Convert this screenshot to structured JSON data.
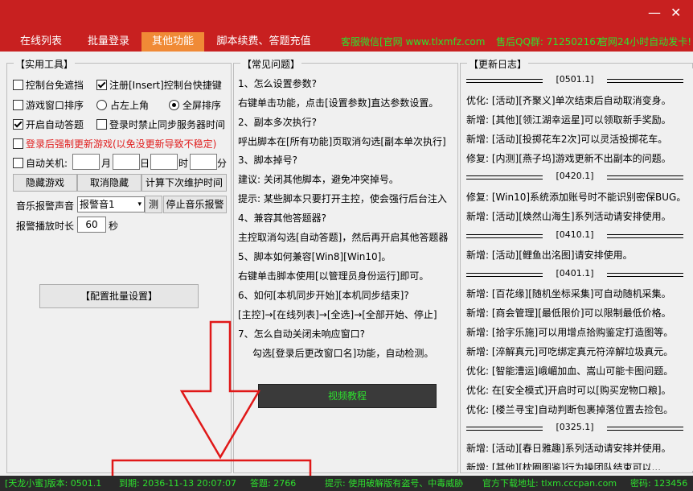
{
  "window": {
    "minimize_label": "—",
    "close_label": "✕"
  },
  "tabs": [
    {
      "label": "在线列表",
      "active": false
    },
    {
      "label": "批量登录",
      "active": false
    },
    {
      "label": "其他功能",
      "active": true
    },
    {
      "label": "脚本续费、答题充值",
      "active": false
    }
  ],
  "header_info": {
    "service": "客服微信[官网  www.tlxmfz.com",
    "qq": "售后QQ群: 712502167",
    "notice": "官网24小时自动发卡!"
  },
  "tools": {
    "title": "【实用工具】",
    "options": [
      {
        "label": "控制台免遮挡",
        "checked": false
      },
      {
        "label": "注册[Insert]控制台快捷键",
        "checked": true
      },
      {
        "label": "游戏窗口排序",
        "checked": false
      },
      {
        "label": "开启自动答题",
        "checked": true
      },
      {
        "label": "登录时禁止同步服务器时间",
        "checked": false
      },
      {
        "label": "登录后强制更新游戏(以免没更新导致不稳定)",
        "checked": false
      },
      {
        "label": "自动关机:",
        "checked": false
      }
    ],
    "radio": [
      {
        "label": "占左上角",
        "checked": false
      },
      {
        "label": "全屏排序",
        "checked": true
      }
    ],
    "shutdown_units": [
      "月",
      "日",
      "时",
      "分"
    ],
    "buttons": {
      "hide_game": "隐藏游戏",
      "cancel_hide": "取消隐藏",
      "calc_maint": "计算下次维护时间"
    },
    "music_label": "音乐报警声音",
    "music_select": "报警音1",
    "test_button": "测",
    "stop_music": "停止音乐报警",
    "duration_label": "报警播放时长",
    "duration_value": "60",
    "duration_unit": "秒",
    "batch_config": "【配置批量设置】"
  },
  "faq": {
    "title": "【常见问题】",
    "lines": [
      "1、怎么设置参数?",
      "右键单击功能，点击[设置参数]直达参数设置。",
      "2、副本多次执行?",
      "呼出脚本在[所有功能]页取消勾选[副本单次执行]",
      "3、脚本掉号?",
      "建议: 关闭其他脚本，避免冲突掉号。",
      "提示: 某些脚本只要打开主控，使会强行后台注入",
      "4、兼容其他答题器?",
      "主控取消勾选[自动答题]，然后再开启其他答题器",
      "5、脚本如何兼容[Win8][Win10]。",
      "右键单击脚本使用[以管理员身份运行]即可。",
      "6、如何[本机同步开始][本机同步结束]?",
      "[主控]→[在线列表]→[全选]→[全部开始、停止]",
      "7、怎么自动关闭未响应窗口?",
      "勾选[登录后更改窗口名]功能，自动检测。"
    ],
    "video_button": "视频教程"
  },
  "changelog": {
    "title": "【更新日志】",
    "entries": [
      {
        "type": "sep",
        "text": "[0501.1]"
      },
      {
        "type": "line",
        "text": "优化: [活动][齐聚义]单次结束后自动取消变身。"
      },
      {
        "type": "line",
        "text": "新增: [其他][领江湖幸运星]可以领取新手奖励。"
      },
      {
        "type": "line",
        "text": "新增: [活动][投掷花车2次]可以灵活投掷花车。"
      },
      {
        "type": "line",
        "text": "修复: [内测][燕子坞]游戏更新不出副本的问题。"
      },
      {
        "type": "sep",
        "text": "[0420.1]"
      },
      {
        "type": "line",
        "text": "修复: [Win10]系统添加账号时不能识别密保BUG。"
      },
      {
        "type": "line",
        "text": "新增: [活动][焕然山海生]系列活动请安排使用。"
      },
      {
        "type": "sep",
        "text": "[0410.1]"
      },
      {
        "type": "line",
        "text": "新增: [活动][鲤鱼出洺图]请安排使用。"
      },
      {
        "type": "sep",
        "text": "[0401.1]"
      },
      {
        "type": "line",
        "text": "新增: [百花缘][随机坐标采集]可自动随机采集。"
      },
      {
        "type": "line",
        "text": "新增: [商会管理][最低限价]可以限制最低价格。"
      },
      {
        "type": "line",
        "text": "新增: [拾字乐施]可以用增点拾购鉴定打造图等。"
      },
      {
        "type": "line",
        "text": "新增: [淬解真元]可吃绑定真元符淬解垃圾真元。"
      },
      {
        "type": "line",
        "text": "优化: [智能漕运]峨嵋加血、嵩山可能卡图问题。"
      },
      {
        "type": "line",
        "text": "优化: 在[安全模式]开启时可以[购买宠物口粮]。"
      },
      {
        "type": "line",
        "text": "优化: [楼兰寻宝]自动判断包裹掉落位置去捡包。"
      },
      {
        "type": "sep",
        "text": "[0325.1]"
      },
      {
        "type": "line",
        "text": "新增: [活动][春日雅趣]系列活动请安排并使用。"
      },
      {
        "type": "line",
        "text": "新增: [其他][枕圈图鉴]行为操团队结束可以..."
      }
    ]
  },
  "status": {
    "version": "[天龙小蜜]版本: 0501.1",
    "expiry": "到期: 2036-11-13 20:07:07",
    "answers": "答题: 2766",
    "tip": "提示: 使用破解版有盗号、中毒威胁",
    "site": "官方下载地址: tlxm.cccpan.com",
    "password": "密码: 123456"
  }
}
